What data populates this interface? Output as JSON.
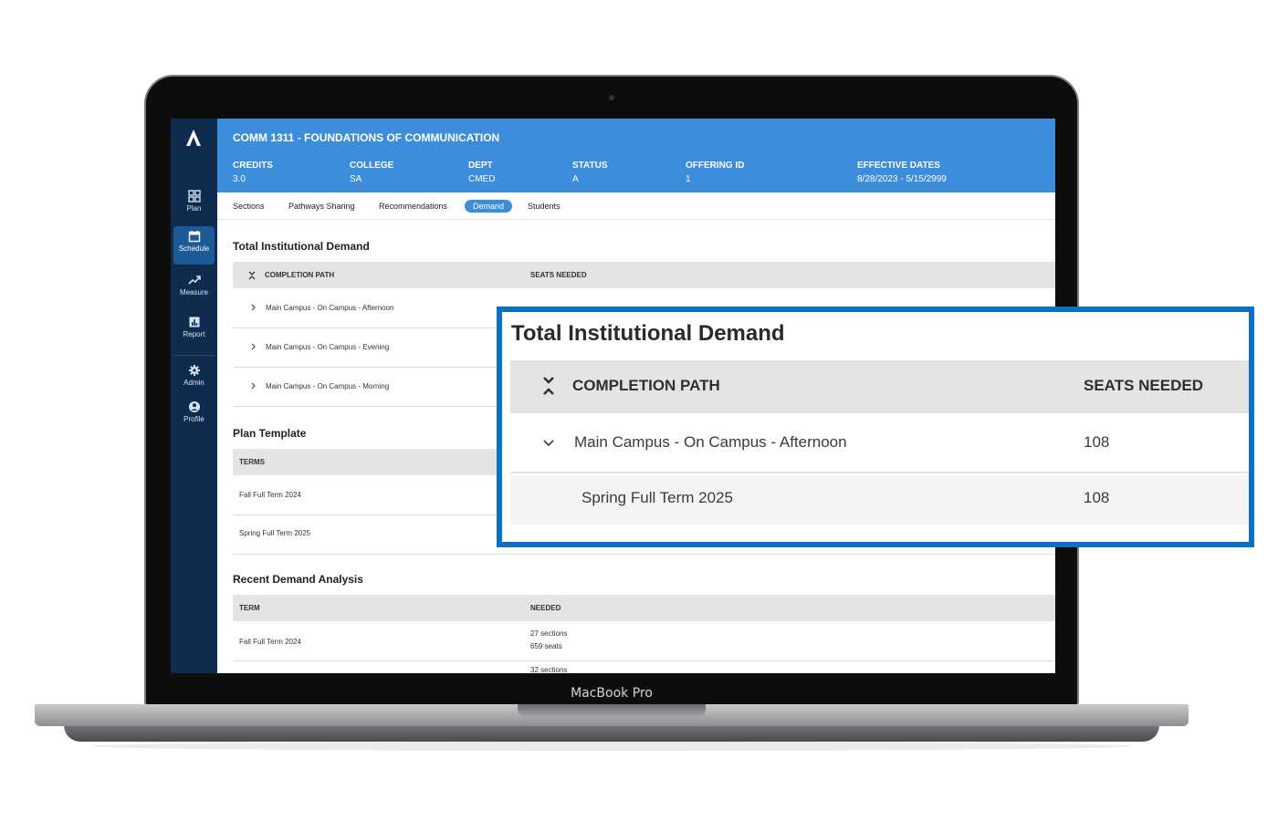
{
  "device": {
    "brand_label": "MacBook Pro"
  },
  "sidebar": {
    "items": [
      {
        "label": "Plan",
        "icon": "grid-icon",
        "active": false
      },
      {
        "label": "Schedule",
        "icon": "calendar-icon",
        "active": true
      },
      {
        "label": "Measure",
        "icon": "trend-icon",
        "active": false
      },
      {
        "label": "Report",
        "icon": "bar-chart-icon",
        "active": false
      },
      {
        "label": "Admin",
        "icon": "gear-icon",
        "active": false
      },
      {
        "label": "Profile",
        "icon": "user-icon",
        "active": false
      }
    ]
  },
  "course": {
    "title": "COMM 1311 - FOUNDATIONS OF COMMUNICATION",
    "meta": [
      {
        "key": "CREDITS",
        "value": "3.0"
      },
      {
        "key": "COLLEGE",
        "value": "SA"
      },
      {
        "key": "DEPT",
        "value": "CMED"
      },
      {
        "key": "STATUS",
        "value": "A"
      },
      {
        "key": "OFFERING ID",
        "value": "1"
      },
      {
        "key": "EFFECTIVE DATES",
        "value": "8/28/2023 - 5/15/2999"
      }
    ]
  },
  "tabs": [
    {
      "label": "Sections",
      "active": false
    },
    {
      "label": "Pathways Sharing",
      "active": false
    },
    {
      "label": "Recommendations",
      "active": false
    },
    {
      "label": "Demand",
      "active": true
    },
    {
      "label": "Students",
      "active": false
    }
  ],
  "demand": {
    "title": "Total Institutional Demand",
    "col_path": "COMPLETION PATH",
    "col_seats": "SEATS NEEDED",
    "rows": [
      {
        "path": "Main Campus - On Campus - Afternoon"
      },
      {
        "path": "Main Campus - On Campus - Evening"
      },
      {
        "path": "Main Campus - On Campus - Morning"
      }
    ]
  },
  "plan_template": {
    "title": "Plan Template",
    "col_terms": "TERMS",
    "rows": [
      {
        "term": "Fall Full Term 2024"
      },
      {
        "term": "Spring Full Term 2025"
      }
    ]
  },
  "recent": {
    "title": "Recent Demand Analysis",
    "col_term": "TERM",
    "col_needed": "NEEDED",
    "rows": [
      {
        "term": "Fall Full Term 2024",
        "sections": "27 sections",
        "seats": "659 seats"
      },
      {
        "term": "",
        "sections": "32 sections",
        "seats": ""
      }
    ]
  },
  "callout": {
    "title": "Total Institutional Demand",
    "col_path": "COMPLETION PATH",
    "col_seats": "SEATS NEEDED",
    "expanded_row": {
      "path": "Main Campus - On Campus - Afternoon",
      "seats": "108"
    },
    "sub_row": {
      "term": "Spring Full Term 2025",
      "seats": "108"
    }
  },
  "colors": {
    "banner": "#3c8ddb",
    "sidebar": "#0f2c4f",
    "callout_border": "#0b6fc2"
  }
}
